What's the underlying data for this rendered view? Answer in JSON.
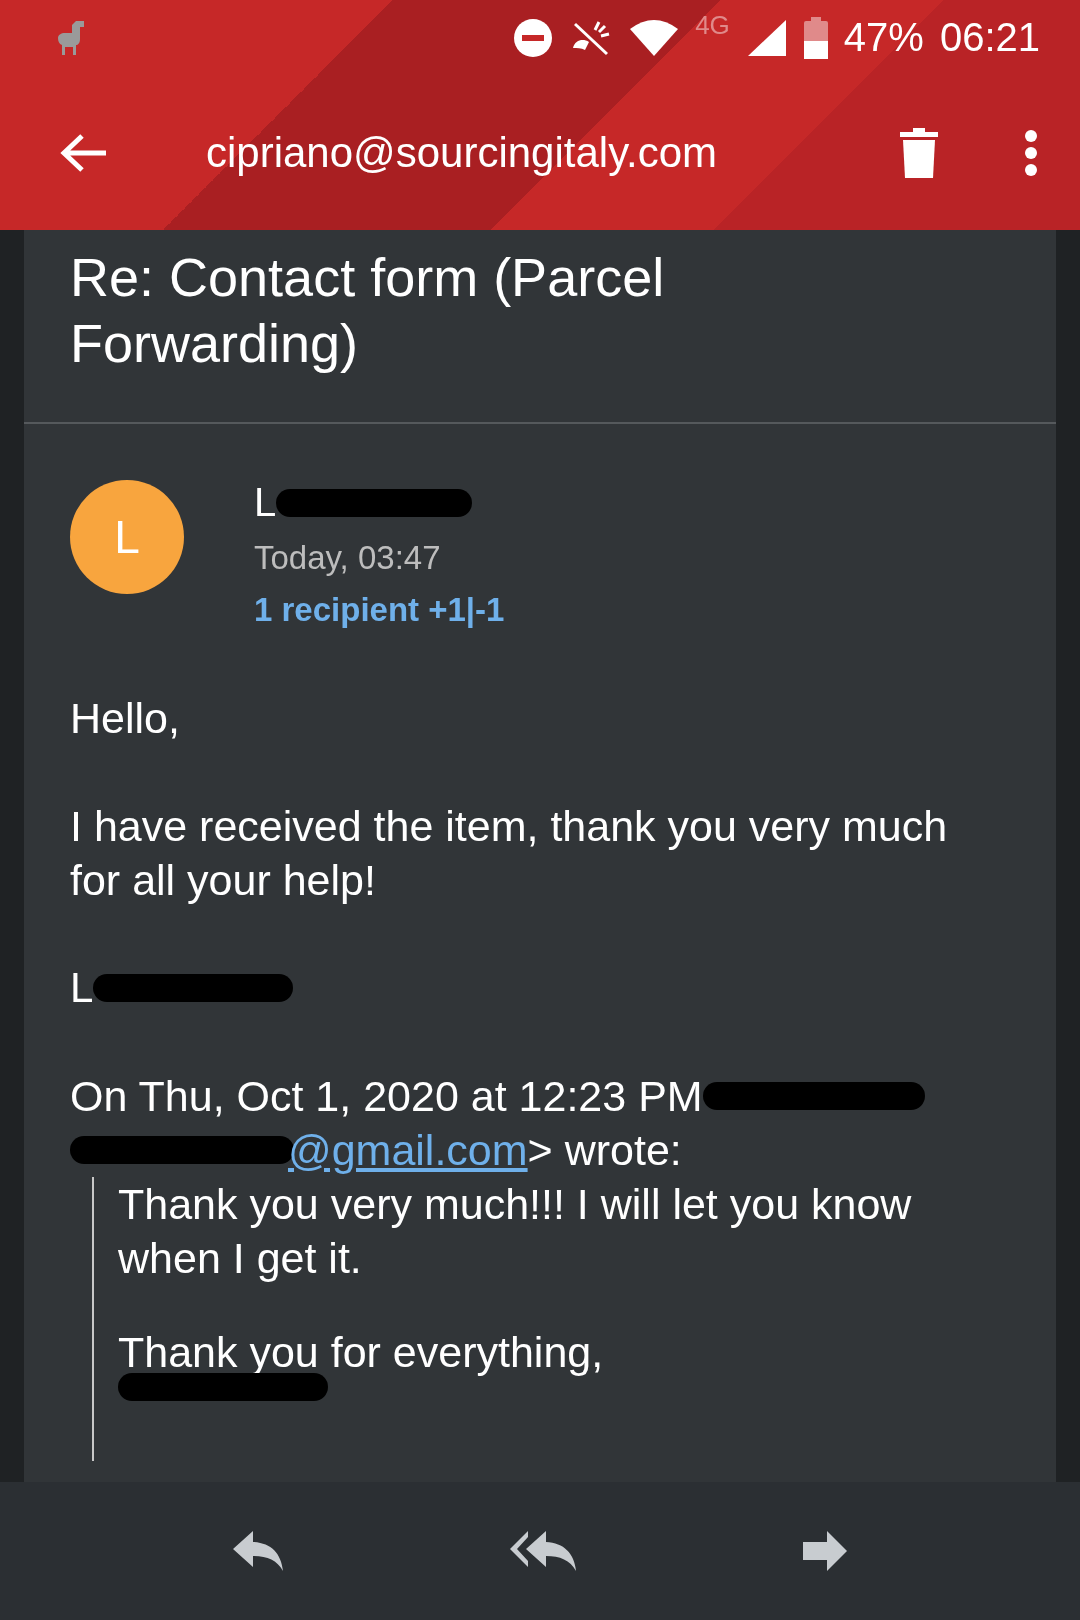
{
  "status_bar": {
    "network": "4G",
    "battery": "47%",
    "time": "06:21"
  },
  "toolbar": {
    "title": "cipriano@sourcingitaly.com"
  },
  "email": {
    "subject": "Re: Contact form (Parcel Forwarding)",
    "sender": {
      "avatar_letter": "L",
      "name": "L",
      "date": "Today, 03:47",
      "recipients": "1 recipient +1|-1"
    },
    "body": [
      "Hello,",
      "I have received the item, thank you very much for all your help!"
    ],
    "signature": "L",
    "quote_header": {
      "line_1": "On Thu, Oct 1, 2020 at 12:23 PM",
      "link": "@gmail.com",
      "after_link": "> wrote:"
    },
    "quoted": [
      "Thank you very much!!!  I will let you know when I get it.",
      "Thank you for everything,"
    ]
  },
  "actions": [
    {
      "kind": "reply"
    },
    {
      "kind": "reply_all"
    },
    {
      "kind": "forward"
    }
  ]
}
